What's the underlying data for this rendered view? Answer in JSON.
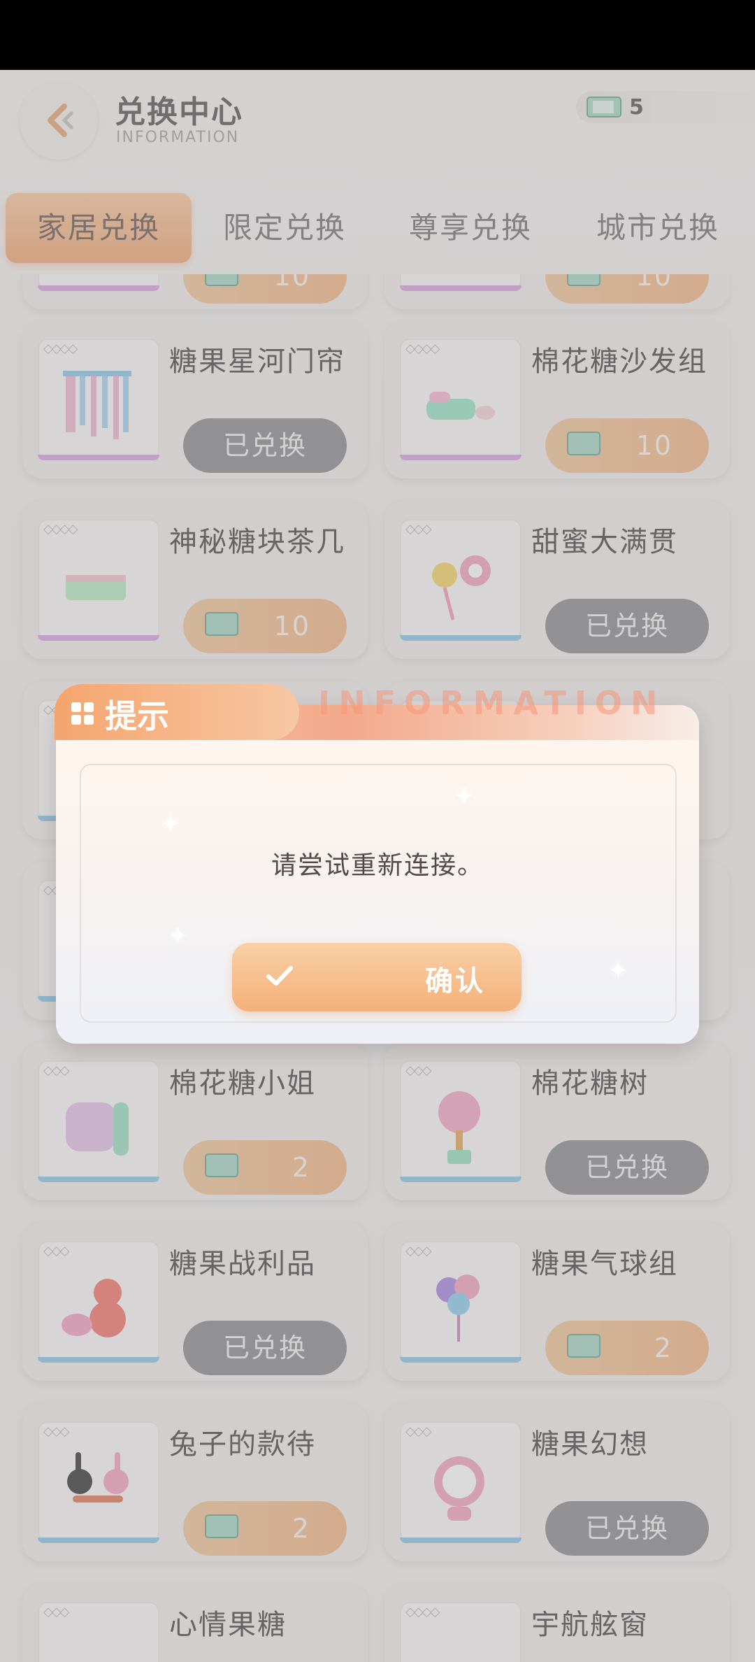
{
  "header": {
    "title": "兑换中心",
    "subtitle": "INFORMATION",
    "currency_count": "5"
  },
  "tabs": [
    {
      "label": "家居兑换",
      "active": true
    },
    {
      "label": "限定兑换",
      "active": false
    },
    {
      "label": "尊享兑换",
      "active": false
    },
    {
      "label": "城市兑换",
      "active": false
    }
  ],
  "items": [
    {
      "name": "",
      "status": "price",
      "price": "10"
    },
    {
      "name": "",
      "status": "price",
      "price": "10"
    },
    {
      "name": "糖果星河门帘",
      "status": "redeemed",
      "label": "已兑换",
      "stars": "◇◇◇◇"
    },
    {
      "name": "棉花糖沙发组",
      "status": "price",
      "price": "10",
      "stars": "◇◇◇◇"
    },
    {
      "name": "神秘糖块茶几",
      "status": "price",
      "price": "10",
      "stars": "◇◇◇◇"
    },
    {
      "name": "甜蜜大满贯",
      "status": "redeemed",
      "label": "已兑换",
      "stars": "◇◇◇"
    },
    {
      "name": "",
      "status": "none",
      "stars": "◇◇◇"
    },
    {
      "name": "",
      "status": "none",
      "stars": "◇◇◇"
    },
    {
      "name": "",
      "status": "none",
      "stars": "◇◇◇"
    },
    {
      "name": "",
      "status": "none",
      "stars": "◇◇◇"
    },
    {
      "name": "棉花糖小姐",
      "status": "price",
      "price": "2",
      "stars": "◇◇◇"
    },
    {
      "name": "棉花糖树",
      "status": "redeemed",
      "label": "已兑换",
      "stars": "◇◇◇"
    },
    {
      "name": "糖果战利品",
      "status": "redeemed",
      "label": "已兑换",
      "stars": "◇◇◇"
    },
    {
      "name": "糖果气球组",
      "status": "price",
      "price": "2",
      "stars": "◇◇◇"
    },
    {
      "name": "兔子的款待",
      "status": "price",
      "price": "2",
      "stars": "◇◇◇"
    },
    {
      "name": "糖果幻想",
      "status": "redeemed",
      "label": "已兑换",
      "stars": "◇◇◇"
    },
    {
      "name": "心情果糖",
      "status": "none",
      "stars": "◇◇◇"
    },
    {
      "name": "宇航舷窗",
      "status": "none",
      "stars": "◇◇◇◇"
    }
  ],
  "dialog": {
    "title": "提示",
    "decor_text": "INFORMATION",
    "message": "请尝试重新连接。",
    "confirm_label": "确认"
  },
  "colors": {
    "accent": "#f3a977",
    "redeemed_button": "#8f8f92",
    "dialog_header": "#f5a56e"
  }
}
